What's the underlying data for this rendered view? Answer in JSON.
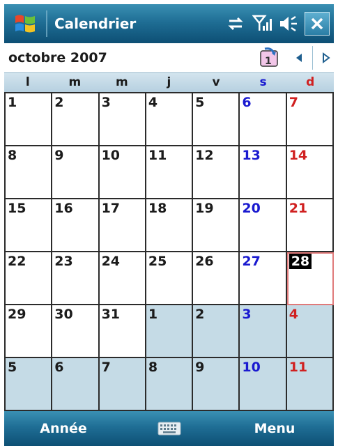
{
  "titlebar": {
    "title": "Calendrier",
    "icons": [
      "windows-start-icon",
      "sync-icon",
      "signal-icon",
      "volume-icon",
      "close-icon"
    ]
  },
  "header": {
    "month": "octobre 2007",
    "today_icon": "today-icon",
    "prev_icon": "left-arrow-icon",
    "next_icon": "right-arrow-icon"
  },
  "weekdays": [
    "l",
    "m",
    "m",
    "j",
    "v",
    "s",
    "d"
  ],
  "weeks": [
    [
      "1",
      "2",
      "3",
      "4",
      "5",
      "6",
      "7"
    ],
    [
      "8",
      "9",
      "10",
      "11",
      "12",
      "13",
      "14"
    ],
    [
      "15",
      "16",
      "17",
      "18",
      "19",
      "20",
      "21"
    ],
    [
      "22",
      "23",
      "24",
      "25",
      "26",
      "27",
      "28"
    ],
    [
      "29",
      "30",
      "31",
      "1",
      "2",
      "3",
      "4"
    ],
    [
      "5",
      "6",
      "7",
      "8",
      "9",
      "10",
      "11"
    ]
  ],
  "today": "28",
  "colors": {
    "bar": "#1f6e95",
    "saturday": "#1a1ad0",
    "sunday": "#d02020",
    "other_month": "#c5dbe6"
  },
  "softkeys": {
    "left": "Année",
    "right": "Menu",
    "center_icon": "keyboard-icon"
  }
}
